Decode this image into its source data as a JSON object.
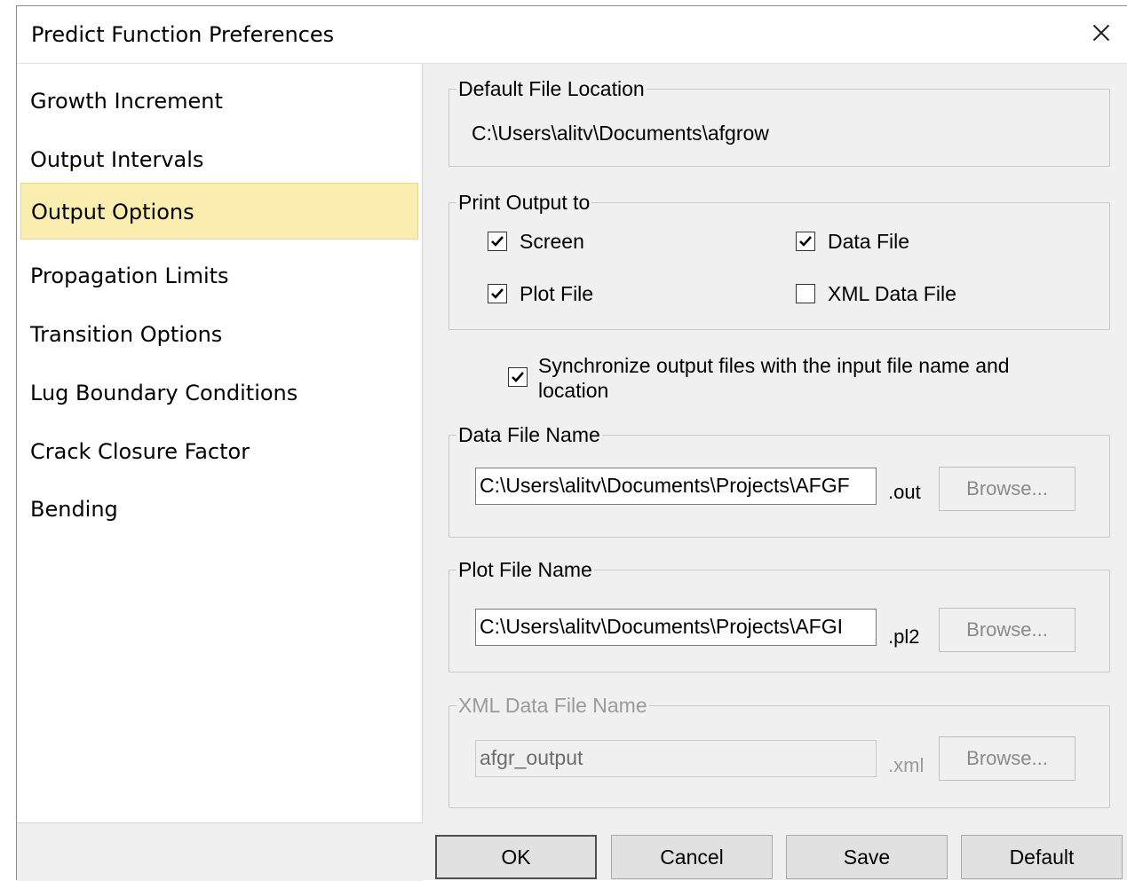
{
  "window": {
    "title": "Predict Function Preferences"
  },
  "sidebar": {
    "items": [
      {
        "label": "Growth Increment"
      },
      {
        "label": "Output Intervals"
      },
      {
        "label": "Output Options"
      },
      {
        "label": "Propagation  Limits"
      },
      {
        "label": "Transition Options"
      },
      {
        "label": "Lug Boundary Conditions"
      },
      {
        "label": "Crack Closure Factor"
      },
      {
        "label": "Bending"
      }
    ],
    "selected": "Output Options"
  },
  "default_location": {
    "legend": "Default File Location",
    "path": "C:\\Users\\alitv\\Documents\\afgrow"
  },
  "print_output": {
    "legend": "Print Output to",
    "screen": {
      "label": "Screen",
      "checked": true
    },
    "data_file": {
      "label": "Data File",
      "checked": true
    },
    "plot_file": {
      "label": "Plot File",
      "checked": true
    },
    "xml_data_file": {
      "label": "XML Data File",
      "checked": false
    }
  },
  "sync": {
    "line1": "Synchronize output files with the input file name and",
    "line2": "location",
    "checked": true
  },
  "data_file_name": {
    "legend": "Data File Name",
    "value": "C:\\Users\\alitv\\Documents\\Projects\\AFGF",
    "ext": ".out",
    "browse": "Browse..."
  },
  "plot_file_name": {
    "legend": "Plot File Name",
    "value": "C:\\Users\\alitv\\Documents\\Projects\\AFGI",
    "ext": ".pl2",
    "browse": "Browse..."
  },
  "xml_file_name": {
    "legend": "XML Data File Name",
    "value": "afgr_output",
    "ext": ".xml",
    "browse": "Browse..."
  },
  "footer": {
    "ok": "OK",
    "cancel": "Cancel",
    "save": "Save",
    "default": "Default"
  }
}
